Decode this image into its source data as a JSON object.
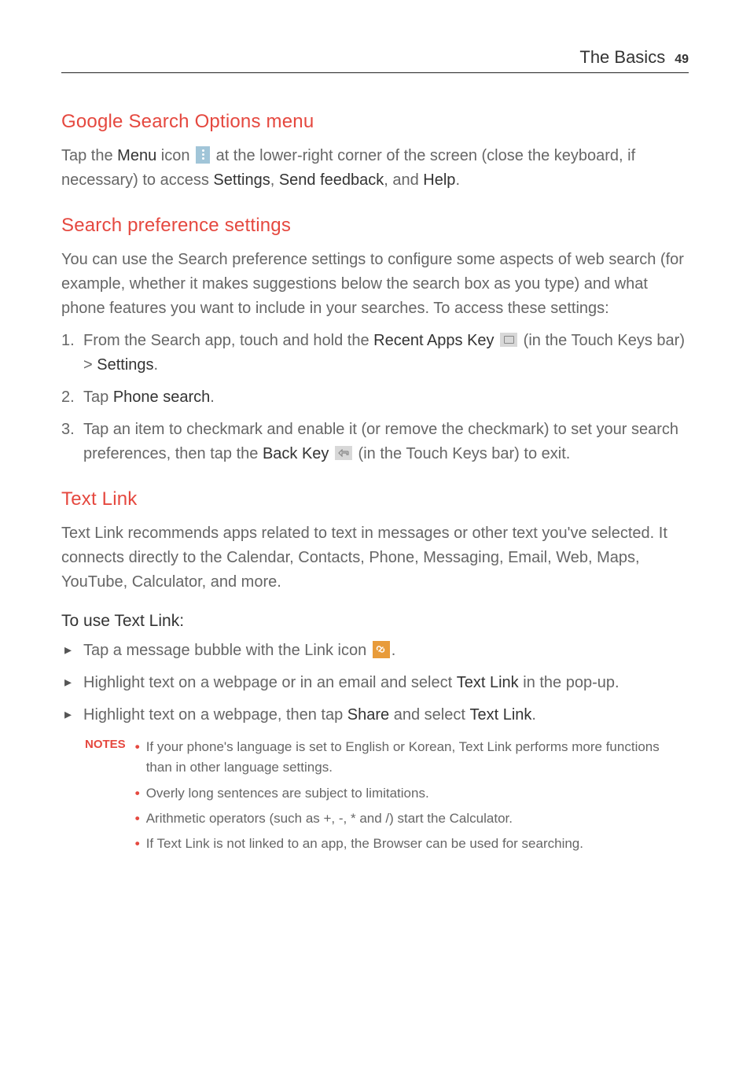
{
  "header": {
    "title": "The Basics",
    "page": "49"
  },
  "section1": {
    "heading": "Google Search Options menu",
    "p1_a": "Tap the ",
    "p1_b": "Menu",
    "p1_c": " icon ",
    "p1_d": " at the lower-right corner of the screen (close the keyboard, if necessary) to access ",
    "p1_e": "Settings",
    "p1_f": ", ",
    "p1_g": "Send feedback",
    "p1_h": ", and ",
    "p1_i": "Help",
    "p1_j": "."
  },
  "section2": {
    "heading": "Search preference settings",
    "p1": "You can use the Search preference settings to configure some aspects of web search (for example, whether it makes suggestions below the search box as you type) and what phone features you want to include in your searches. To access these settings:",
    "li1_a": "From the Search app, touch and hold the ",
    "li1_b": "Recent Apps Key",
    "li1_c": " ",
    "li1_d": " (in the Touch Keys bar) > ",
    "li1_e": "Settings",
    "li1_f": ".",
    "li2_a": "Tap ",
    "li2_b": "Phone search",
    "li2_c": ".",
    "li3_a": "Tap an item to checkmark and enable it (or remove the checkmark) to set your search preferences, then tap the ",
    "li3_b": "Back Key",
    "li3_c": " ",
    "li3_d": " (in the Touch Keys bar) to exit."
  },
  "section3": {
    "heading": "Text Link",
    "p1": "Text Link recommends apps related to text in messages or other text you've selected. It connects directly to the Calendar, Contacts, Phone, Messaging, Email, Web, Maps, YouTube, Calculator, and more.",
    "h2": "To use Text Link:",
    "li1_a": "Tap a message bubble with the Link icon ",
    "li1_b": ".",
    "li2_a": "Highlight text on a webpage or in an email and select ",
    "li2_b": "Text Link",
    "li2_c": " in the pop-up.",
    "li3_a": "Highlight text on a webpage, then tap ",
    "li3_b": "Share",
    "li3_c": " and select ",
    "li3_d": "Text Link",
    "li3_e": "."
  },
  "notes": {
    "label": "NOTES",
    "items": [
      "If your phone's language is set to English or Korean, Text Link performs more functions than in other language settings.",
      "Overly long sentences are subject to limitations.",
      "Arithmetic operators (such as +, -, * and /) start the Calculator.",
      "If Text Link is not linked to an app, the Browser can be used for searching."
    ]
  }
}
